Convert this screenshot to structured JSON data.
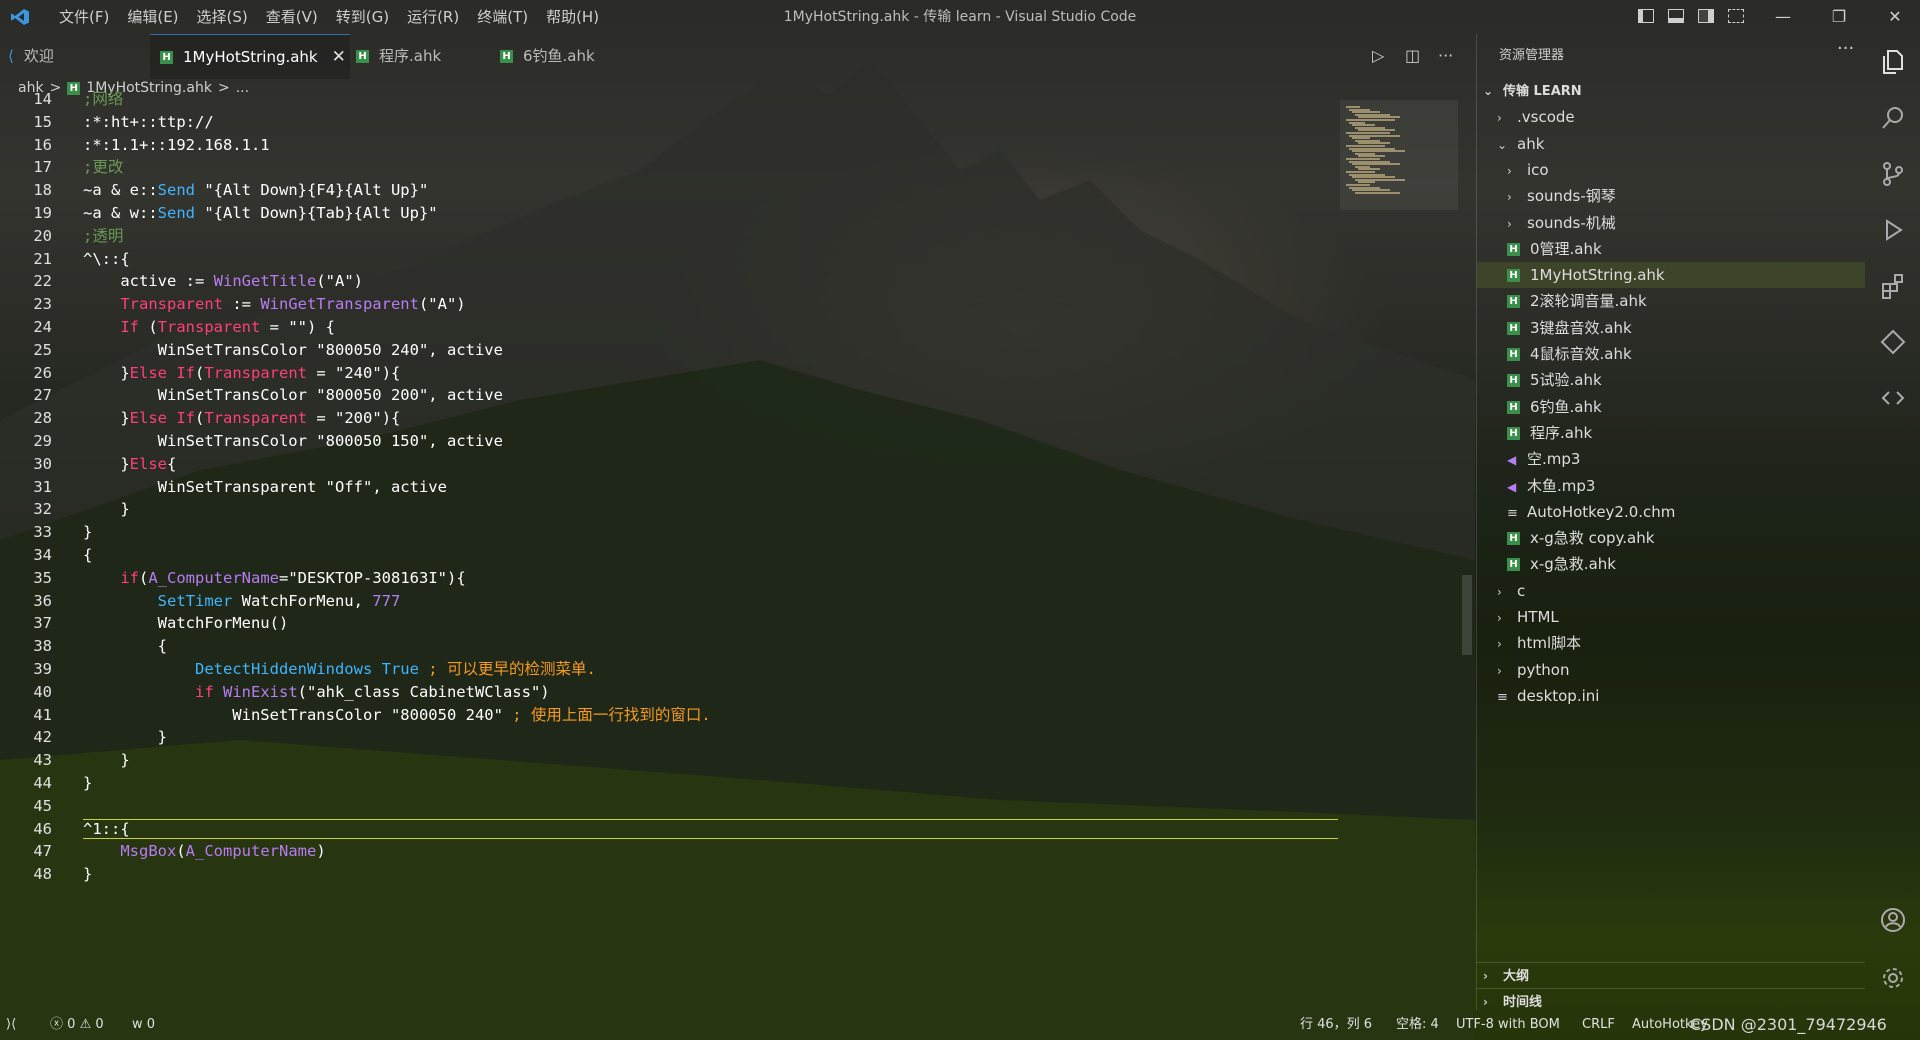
{
  "app": {
    "window_title": "1MyHotString.ahk - 传输 learn - Visual Studio Code",
    "menu": [
      "文件(F)",
      "编辑(E)",
      "选择(S)",
      "查看(V)",
      "转到(G)",
      "运行(R)",
      "终端(T)",
      "帮助(H)"
    ]
  },
  "tabs": [
    {
      "label": "欢迎",
      "icon": "vscode-logo-icon"
    },
    {
      "label": "1MyHotString.ahk",
      "icon": "ahk-file-icon",
      "active": true
    },
    {
      "label": "程序.ahk",
      "icon": "ahk-file-icon"
    },
    {
      "label": "6钓鱼.ahk",
      "icon": "ahk-file-icon"
    }
  ],
  "breadcrumb": [
    "ahk",
    ">",
    "1MyHotString.ahk",
    ">",
    "..."
  ],
  "editor": {
    "lines": [
      {
        "n": "14",
        "text": ";网络"
      },
      {
        "n": "15",
        "text": ":*:ht+::ttp://"
      },
      {
        "n": "16",
        "text": ":*:1.1+::192.168.1.1"
      },
      {
        "n": "17",
        "text": ";更改"
      },
      {
        "n": "18",
        "text": "~a & e::Send \"{Alt Down}{F4}{Alt Up}\""
      },
      {
        "n": "19",
        "text": "~a & w::Send \"{Alt Down}{Tab}{Alt Up}\""
      },
      {
        "n": "20",
        "text": ";透明"
      },
      {
        "n": "21",
        "text": "^\\::{"
      },
      {
        "n": "22",
        "text": "    active := WinGetTitle(\"A\")"
      },
      {
        "n": "23",
        "text": "    Transparent := WinGetTransparent(\"A\")"
      },
      {
        "n": "24",
        "text": "    If (Transparent = \"\") {"
      },
      {
        "n": "25",
        "text": "        WinSetTransColor \"800050 240\", active"
      },
      {
        "n": "26",
        "text": "    }Else If(Transparent = \"240\"){"
      },
      {
        "n": "27",
        "text": "        WinSetTransColor \"800050 200\", active"
      },
      {
        "n": "28",
        "text": "    }Else If(Transparent = \"200\"){"
      },
      {
        "n": "29",
        "text": "        WinSetTransColor \"800050 150\", active"
      },
      {
        "n": "30",
        "text": "    }Else{"
      },
      {
        "n": "31",
        "text": "        WinSetTransparent \"Off\", active"
      },
      {
        "n": "32",
        "text": "    }"
      },
      {
        "n": "33",
        "text": "}"
      },
      {
        "n": "34",
        "text": "{"
      },
      {
        "n": "35",
        "text": "    if(A_ComputerName=\"DESKTOP-308163I\"){"
      },
      {
        "n": "36",
        "text": "        SetTimer WatchForMenu, 777"
      },
      {
        "n": "37",
        "text": "        WatchForMenu()"
      },
      {
        "n": "38",
        "text": "        {"
      },
      {
        "n": "39",
        "text": "            DetectHiddenWindows True ; 可以更早的检测菜单."
      },
      {
        "n": "40",
        "text": "            if WinExist(\"ahk_class CabinetWClass\")"
      },
      {
        "n": "41",
        "text": "                WinSetTransColor \"800050 240\" ; 使用上面一行找到的窗口."
      },
      {
        "n": "42",
        "text": "        }"
      },
      {
        "n": "43",
        "text": "    }"
      },
      {
        "n": "44",
        "text": "}"
      },
      {
        "n": "45",
        "text": ""
      },
      {
        "n": "46",
        "text": "^1::{"
      },
      {
        "n": "47",
        "text": "    MsgBox(A_ComputerName)"
      },
      {
        "n": "48",
        "text": "}"
      }
    ]
  },
  "explorer": {
    "title": "资源管理器",
    "root": "传输 LEARN",
    "items": [
      {
        "label": ".vscode",
        "type": "folder-collapsed",
        "depth": 1
      },
      {
        "label": "ahk",
        "type": "folder-open",
        "depth": 1
      },
      {
        "label": "ico",
        "type": "folder-collapsed",
        "depth": 2
      },
      {
        "label": "sounds-钢琴",
        "type": "folder-collapsed",
        "depth": 2
      },
      {
        "label": "sounds-机械",
        "type": "folder-collapsed",
        "depth": 2
      },
      {
        "label": "0管理.ahk",
        "type": "ahk",
        "depth": 2
      },
      {
        "label": "1MyHotString.ahk",
        "type": "ahk",
        "depth": 2,
        "selected": true
      },
      {
        "label": "2滚轮调音量.ahk",
        "type": "ahk",
        "depth": 2
      },
      {
        "label": "3键盘音效.ahk",
        "type": "ahk",
        "depth": 2
      },
      {
        "label": "4鼠标音效.ahk",
        "type": "ahk",
        "depth": 2
      },
      {
        "label": "5试验.ahk",
        "type": "ahk",
        "depth": 2
      },
      {
        "label": "6钓鱼.ahk",
        "type": "ahk",
        "depth": 2
      },
      {
        "label": "程序.ahk",
        "type": "ahk",
        "depth": 2
      },
      {
        "label": "空.mp3",
        "type": "audio",
        "depth": 2
      },
      {
        "label": "木鱼.mp3",
        "type": "audio",
        "depth": 2
      },
      {
        "label": "AutoHotkey2.0.chm",
        "type": "text",
        "depth": 2
      },
      {
        "label": "x-g急救 copy.ahk",
        "type": "ahk",
        "depth": 2
      },
      {
        "label": "x-g急救.ahk",
        "type": "ahk",
        "depth": 2
      },
      {
        "label": "c",
        "type": "folder-collapsed",
        "depth": 1
      },
      {
        "label": "HTML",
        "type": "folder-collapsed",
        "depth": 1
      },
      {
        "label": "html脚本",
        "type": "folder-collapsed",
        "depth": 1
      },
      {
        "label": "python",
        "type": "folder-collapsed",
        "depth": 1
      },
      {
        "label": "desktop.ini",
        "type": "text",
        "depth": 1
      }
    ],
    "sections": [
      "大纲",
      "时间线"
    ]
  },
  "statusbar": {
    "errors": "0",
    "warnings": "0",
    "ports": "0",
    "position": "行 46，列 6",
    "indent": "空格: 4",
    "encoding": "UTF-8 with BOM",
    "eol": "CRLF",
    "language": "AutoHotkey",
    "watermark": "CSDN @2301_79472946"
  },
  "colors": {
    "accent": "#2e6db4",
    "keyword": "#ff3f7b",
    "function": "#b77cf2",
    "comment": "#6a9955",
    "current_line": "#c8d23a"
  }
}
